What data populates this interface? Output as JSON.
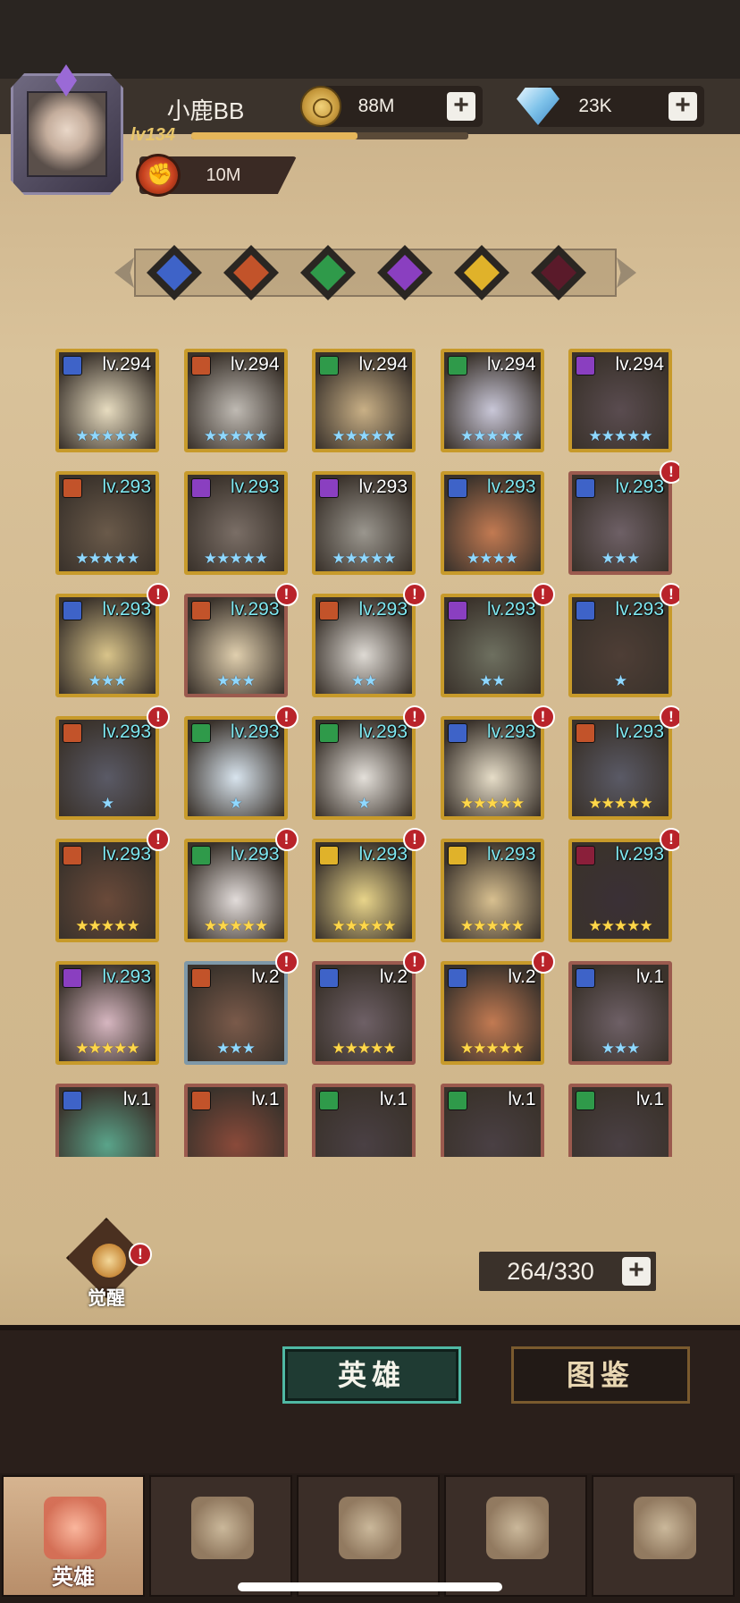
{
  "player": {
    "name": "小鹿BB",
    "level": "lv134",
    "xp_fraction": 0.6,
    "power": "10M"
  },
  "resources": {
    "gold": "88M",
    "diamonds": "23K"
  },
  "colors": {
    "gold_border": "#c79a2a",
    "cyan_level": "#7fe7f0",
    "accent_tab": "#4fb8a4"
  },
  "filters": [
    {
      "name": "blue-faction-icon",
      "color": "#3e63c8"
    },
    {
      "name": "orange-faction-icon",
      "color": "#c2532a"
    },
    {
      "name": "green-faction-icon",
      "color": "#2f9a4a"
    },
    {
      "name": "purple-faction-icon",
      "color": "#8a3fc0"
    },
    {
      "name": "yellow-faction-icon",
      "color": "#e0b22a"
    },
    {
      "name": "dark-faction-icon",
      "color": "#5a1a2a"
    }
  ],
  "heroes": [
    {
      "level": "lv.294",
      "stars": "★★★★★",
      "star_color": "blue",
      "lv_color": "white",
      "badge": "#3e63c8",
      "portrait": "#e7dcc0",
      "alert": false,
      "border": "gold"
    },
    {
      "level": "lv.294",
      "stars": "★★★★★",
      "star_color": "blue",
      "lv_color": "white",
      "badge": "#c2532a",
      "portrait": "#bfbab3",
      "alert": false,
      "border": "gold"
    },
    {
      "level": "lv.294",
      "stars": "★★★★★",
      "star_color": "blue",
      "lv_color": "white",
      "badge": "#2f9a4a",
      "portrait": "#c9b086",
      "alert": false,
      "border": "gold"
    },
    {
      "level": "lv.294",
      "stars": "★★★★★",
      "star_color": "blue",
      "lv_color": "white",
      "badge": "#2f9a4a",
      "portrait": "#c9c7d8",
      "alert": false,
      "border": "gold"
    },
    {
      "level": "lv.294",
      "stars": "★★★★★",
      "star_color": "blue",
      "lv_color": "white",
      "badge": "#8a3fc0",
      "portrait": "#5a4c50",
      "alert": false,
      "border": "gold"
    },
    {
      "level": "lv.293",
      "stars": "★★★★★",
      "star_color": "blue",
      "lv_color": "cyan",
      "badge": "#c2532a",
      "portrait": "#6a5a4a",
      "alert": false,
      "border": "gold"
    },
    {
      "level": "lv.293",
      "stars": "★★★★★",
      "star_color": "blue",
      "lv_color": "cyan",
      "badge": "#8a3fc0",
      "portrait": "#7a6e66",
      "alert": false,
      "border": "gold"
    },
    {
      "level": "lv.293",
      "stars": "★★★★★",
      "star_color": "blue",
      "lv_color": "white",
      "badge": "#8a3fc0",
      "portrait": "#9a968e",
      "alert": false,
      "border": "gold"
    },
    {
      "level": "lv.293",
      "stars": "★★★★",
      "star_color": "blue",
      "lv_color": "cyan",
      "badge": "#3e63c8",
      "portrait": "#c27a52",
      "alert": false,
      "border": "gold"
    },
    {
      "level": "lv.293",
      "stars": "★★★",
      "star_color": "blue",
      "lv_color": "cyan",
      "badge": "#3e63c8",
      "portrait": "#6e6066",
      "alert": true,
      "border": "red"
    },
    {
      "level": "lv.293",
      "stars": "★★★",
      "star_color": "blue",
      "lv_color": "cyan",
      "badge": "#3e63c8",
      "portrait": "#d9c48a",
      "alert": true,
      "border": "gold"
    },
    {
      "level": "lv.293",
      "stars": "★★★",
      "star_color": "blue",
      "lv_color": "cyan",
      "badge": "#c2532a",
      "portrait": "#e0cfae",
      "alert": true,
      "border": "red"
    },
    {
      "level": "lv.293",
      "stars": "★★",
      "star_color": "blue",
      "lv_color": "cyan",
      "badge": "#c2532a",
      "portrait": "#dedad4",
      "alert": true,
      "border": "gold"
    },
    {
      "level": "lv.293",
      "stars": "★★",
      "star_color": "blue",
      "lv_color": "cyan",
      "badge": "#8a3fc0",
      "portrait": "#6e7060",
      "alert": true,
      "border": "gold"
    },
    {
      "level": "lv.293",
      "stars": "★",
      "star_color": "blue",
      "lv_color": "cyan",
      "badge": "#3e63c8",
      "portrait": "#4e3e36",
      "alert": true,
      "border": "gold"
    },
    {
      "level": "lv.293",
      "stars": "★",
      "star_color": "blue",
      "lv_color": "cyan",
      "badge": "#c2532a",
      "portrait": "#5a5a66",
      "alert": true,
      "border": "gold"
    },
    {
      "level": "lv.293",
      "stars": "★",
      "star_color": "blue",
      "lv_color": "cyan",
      "badge": "#2f9a4a",
      "portrait": "#d8e4ee",
      "alert": true,
      "border": "gold"
    },
    {
      "level": "lv.293",
      "stars": "★",
      "star_color": "blue",
      "lv_color": "cyan",
      "badge": "#2f9a4a",
      "portrait": "#e4e0da",
      "alert": true,
      "border": "gold"
    },
    {
      "level": "lv.293",
      "stars": "★★★★★",
      "star_color": "gold",
      "lv_color": "cyan",
      "badge": "#3e63c8",
      "portrait": "#e6ddc8",
      "alert": true,
      "border": "gold"
    },
    {
      "level": "lv.293",
      "stars": "★★★★★",
      "star_color": "gold",
      "lv_color": "cyan",
      "badge": "#c2532a",
      "portrait": "#5a5a66",
      "alert": true,
      "border": "gold"
    },
    {
      "level": "lv.293",
      "stars": "★★★★★",
      "star_color": "gold",
      "lv_color": "cyan",
      "badge": "#c2532a",
      "portrait": "#6a4a3a",
      "alert": true,
      "border": "gold"
    },
    {
      "level": "lv.293",
      "stars": "★★★★★",
      "star_color": "gold",
      "lv_color": "cyan",
      "badge": "#2f9a4a",
      "portrait": "#e2dcda",
      "alert": true,
      "border": "gold"
    },
    {
      "level": "lv.293",
      "stars": "★★★★★",
      "star_color": "gold",
      "lv_color": "cyan",
      "badge": "#e0b22a",
      "portrait": "#e8d48a",
      "alert": true,
      "border": "gold"
    },
    {
      "level": "lv.293",
      "stars": "★★★★★",
      "star_color": "gold",
      "lv_color": "cyan",
      "badge": "#e0b22a",
      "portrait": "#d8c090",
      "alert": false,
      "border": "gold"
    },
    {
      "level": "lv.293",
      "stars": "★★★★★",
      "star_color": "gold",
      "lv_color": "cyan",
      "badge": "#8a1f3a",
      "portrait": "#3a3036",
      "alert": true,
      "border": "gold"
    },
    {
      "level": "lv.293",
      "stars": "★★★★★",
      "star_color": "gold",
      "lv_color": "cyan",
      "badge": "#8a3fc0",
      "portrait": "#d6b6c0",
      "alert": false,
      "border": "gold"
    },
    {
      "level": "lv.2",
      "stars": "★★★",
      "star_color": "blue",
      "lv_color": "white",
      "badge": "#c2532a",
      "portrait": "#7a5a4a",
      "alert": true,
      "border": "blue"
    },
    {
      "level": "lv.2",
      "stars": "★★★★★",
      "star_color": "gold",
      "lv_color": "white",
      "badge": "#3e63c8",
      "portrait": "#6e6066",
      "alert": true,
      "border": "red"
    },
    {
      "level": "lv.2",
      "stars": "★★★★★",
      "star_color": "gold",
      "lv_color": "white",
      "badge": "#3e63c8",
      "portrait": "#c27a52",
      "alert": true,
      "border": "gold"
    },
    {
      "level": "lv.1",
      "stars": "★★★",
      "star_color": "blue",
      "lv_color": "white",
      "badge": "#3e63c8",
      "portrait": "#6e6066",
      "alert": false,
      "border": "red"
    },
    {
      "level": "lv.1",
      "stars": "",
      "star_color": "blue",
      "lv_color": "white",
      "badge": "#3e63c8",
      "portrait": "#5aa48a",
      "alert": false,
      "border": "red"
    },
    {
      "level": "lv.1",
      "stars": "",
      "star_color": "blue",
      "lv_color": "white",
      "badge": "#c2532a",
      "portrait": "#8a4a3a",
      "alert": false,
      "border": "red"
    },
    {
      "level": "lv.1",
      "stars": "",
      "star_color": "blue",
      "lv_color": "white",
      "badge": "#2f9a4a",
      "portrait": "#4a4044",
      "alert": false,
      "border": "red"
    },
    {
      "level": "lv.1",
      "stars": "",
      "star_color": "blue",
      "lv_color": "white",
      "badge": "#2f9a4a",
      "portrait": "#4a4044",
      "alert": false,
      "border": "red"
    },
    {
      "level": "lv.1",
      "stars": "",
      "star_color": "blue",
      "lv_color": "white",
      "badge": "#2f9a4a",
      "portrait": "#4a4044",
      "alert": false,
      "border": "red"
    }
  ],
  "awaken_label": "觉醒",
  "alert_glyph": "!",
  "plus_glyph": "+",
  "capacity": "264/330",
  "tabs": {
    "heroes": "英雄",
    "codex": "图鉴"
  },
  "nav": [
    {
      "label": "英雄",
      "icon": "helmet-icon",
      "active": true
    },
    {
      "label": "",
      "icon": "ship-icon",
      "active": false
    },
    {
      "label": "",
      "icon": "battle-icon",
      "active": false
    },
    {
      "label": "",
      "icon": "castle-icon",
      "active": false
    },
    {
      "label": "",
      "icon": "guild-icon",
      "active": false
    }
  ]
}
